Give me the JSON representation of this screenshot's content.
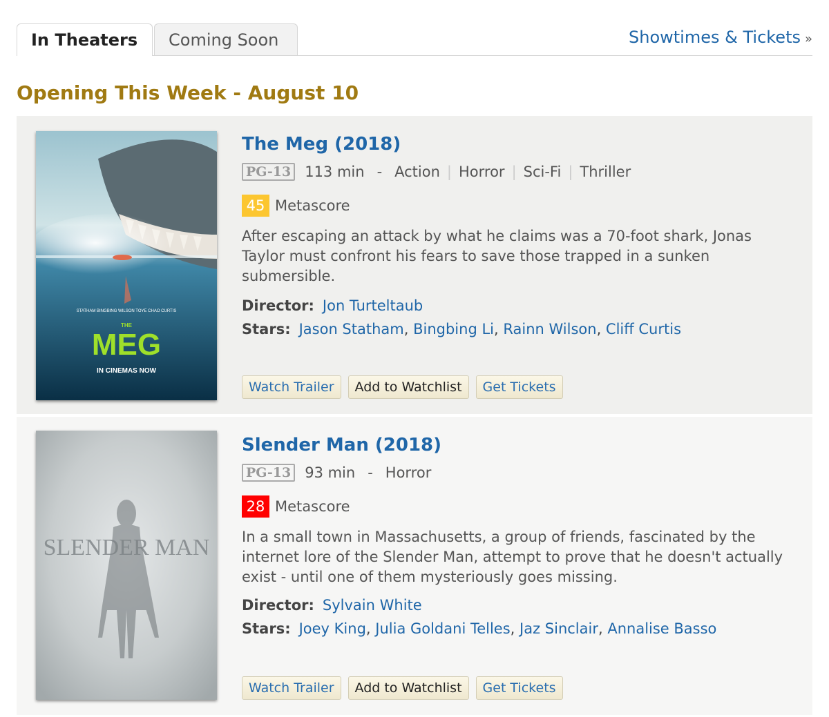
{
  "tabs": [
    {
      "label": "In Theaters",
      "active": true
    },
    {
      "label": "Coming Soon",
      "active": false
    }
  ],
  "showtimes_link": "Showtimes & Tickets",
  "showtimes_raquo": "»",
  "section_title": "Opening This Week - August 10",
  "colors": {
    "link": "#1f66a8",
    "section_title": "#a07a12",
    "metascore_mixed": "#fcc630",
    "metascore_bad": "#ff0000"
  },
  "movies": [
    {
      "title": "The Meg (2018)",
      "certificate": "PG-13",
      "runtime": "113 min",
      "dash": "-",
      "genres": [
        "Action",
        "Horror",
        "Sci-Fi",
        "Thriller"
      ],
      "metascore": "45",
      "metascore_label": "Metascore",
      "outline": "After escaping an attack by what he claims was a 70-foot shark, Jonas Taylor must confront his fears to save those trapped in a sunken submersible.",
      "director_label": "Director:",
      "director": "Jon Turteltaub",
      "stars_label": "Stars:",
      "stars": [
        "Jason Statham",
        "Bingbing Li",
        "Rainn Wilson",
        "Cliff Curtis"
      ],
      "poster": {
        "title_small": "THE",
        "title_big": "MEG",
        "cast_line": "STATHAM BINGBING WILSON TOYE CHAO CURTIS",
        "tagline": "IN CINEMAS NOW"
      },
      "buttons": {
        "trailer": "Watch Trailer",
        "watchlist": "Add to Watchlist",
        "tickets": "Get Tickets"
      }
    },
    {
      "title": "Slender Man (2018)",
      "certificate": "PG-13",
      "runtime": "93 min",
      "dash": "-",
      "genres": [
        "Horror"
      ],
      "metascore": "28",
      "metascore_label": "Metascore",
      "outline": "In a small town in Massachusetts, a group of friends, fascinated by the internet lore of the Slender Man, attempt to prove that he doesn't actually exist - until one of them mysteriously goes missing.",
      "director_label": "Director:",
      "director": "Sylvain White",
      "stars_label": "Stars:",
      "stars": [
        "Joey King",
        "Julia Goldani Telles",
        "Jaz Sinclair",
        "Annalise Basso"
      ],
      "poster": {
        "title_big": "SLENDER MAN"
      },
      "buttons": {
        "trailer": "Watch Trailer",
        "watchlist": "Add to Watchlist",
        "tickets": "Get Tickets"
      }
    }
  ]
}
